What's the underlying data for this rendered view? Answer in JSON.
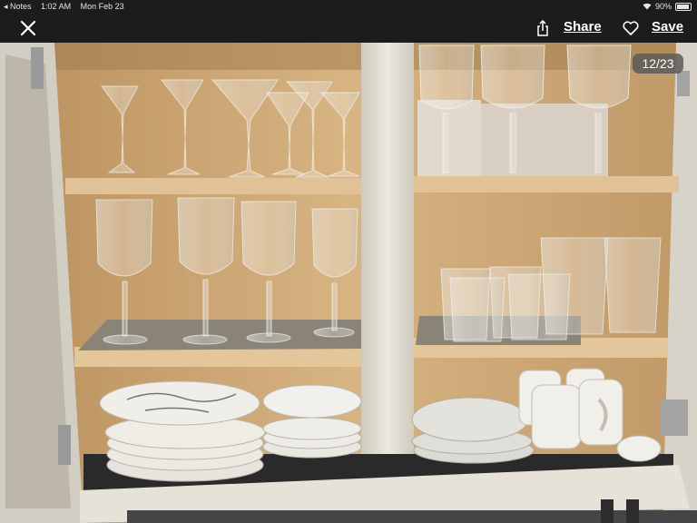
{
  "status_bar": {
    "back_app": "◂ Notes",
    "time": "1:02 AM",
    "date": "Mon Feb 23",
    "battery": "90%",
    "battery_level": 0.9
  },
  "toolbar": {
    "close_icon": "close-icon",
    "share_icon": "share-icon",
    "share_label": "Share",
    "favorite_icon": "heart-icon",
    "save_label": "Save"
  },
  "image_counter": "12/23",
  "colors": {
    "bar_background": "#1c1c1c",
    "cabinet_wood": "#caa675",
    "cabinet_frame": "#ddd8cc",
    "shelf_liner": "#2a2a2a"
  }
}
